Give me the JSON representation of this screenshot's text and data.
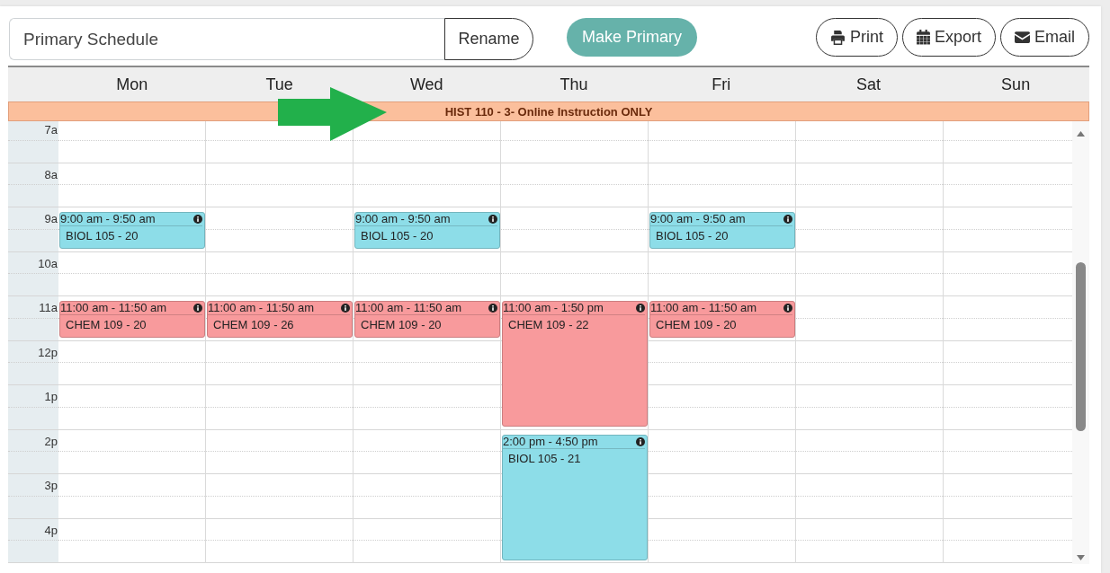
{
  "toolbar": {
    "name_field": {
      "value": "Primary Schedule"
    },
    "rename_button": "Rename",
    "primary_button": "Make Primary",
    "actions": [
      {
        "label": "Print",
        "kind": "print"
      },
      {
        "label": "Export",
        "kind": "export"
      },
      {
        "label": "Email",
        "kind": "email"
      }
    ]
  },
  "calendar": {
    "days": [
      {
        "label": "Mon",
        "events": [
          {
            "time": "9:00 am - 9:50 am",
            "title": "BIOL 105 - 20",
            "color": "#8ddde8"
          },
          {
            "time": "11:00 am - 11:50 am",
            "title": "CHEM 109 - 20",
            "color": "#f89a9c"
          }
        ]
      },
      {
        "label": "Tue",
        "events": [
          {
            "time": "11:00 am - 11:50 am",
            "title": "CHEM 109 - 26",
            "color": "#f89a9c"
          }
        ]
      },
      {
        "label": "Wed",
        "events": [
          {
            "time": "9:00 am - 9:50 am",
            "title": "BIOL 105 - 20",
            "color": "#8ddde8"
          },
          {
            "time": "11:00 am - 11:50 am",
            "title": "CHEM 109 - 20",
            "color": "#f89a9c"
          }
        ]
      },
      {
        "label": "Thu",
        "events": [
          {
            "time": "11:00 am - 1:50 pm",
            "title": "CHEM 109 - 22",
            "color": "#f89a9c"
          },
          {
            "time": "2:00 pm - 4:50 pm",
            "title": "BIOL 105 - 21",
            "color": "#8ddde8"
          }
        ]
      },
      {
        "label": "Fri",
        "events": [
          {
            "time": "9:00 am - 9:50 am",
            "title": "BIOL 105 - 20",
            "color": "#8ddde8"
          },
          {
            "time": "11:00 am - 11:50 am",
            "title": "CHEM 109 - 20",
            "color": "#f89a9c"
          }
        ]
      },
      {
        "label": "Sat"
      },
      {
        "label": "Sun"
      }
    ],
    "all_day_event": "HIST 110 - 3- Online Instruction ONLY",
    "time_labels": [
      "7a",
      "8a",
      "9a",
      "10a",
      "11a",
      "12p",
      "1p",
      "2p",
      "3p",
      "4p"
    ]
  },
  "annotations": [
    {
      "kind": "arrow"
    }
  ]
}
